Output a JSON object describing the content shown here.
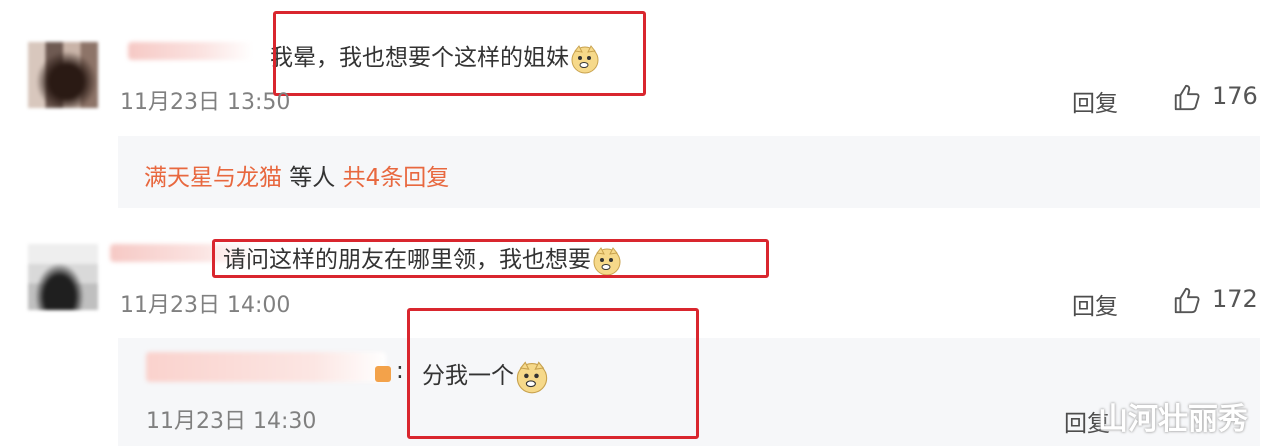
{
  "comments": [
    {
      "text": "我晕，我也想要个这样的姐妹",
      "time": "11月23日 13:50",
      "reply_label": "回复",
      "likes": "176",
      "sub_replies": {
        "name": "满天星与龙猫",
        "middle": " 等人 ",
        "count_text": "共4条回复"
      }
    },
    {
      "text": "请问这样的朋友在哪里领，我也想要",
      "time": "11月23日 14:00",
      "reply_label": "回复",
      "likes": "172",
      "reply": {
        "text": "分我一个",
        "time": "11月23日 14:30",
        "reply_label": "回复"
      }
    }
  ],
  "watermark": "山河壮丽秀",
  "colors": {
    "highlight_box": "#d9262e",
    "link": "#e8683f",
    "timestamp": "#808080"
  },
  "icons": [
    "doge-emoji",
    "thumbs-up-icon"
  ]
}
